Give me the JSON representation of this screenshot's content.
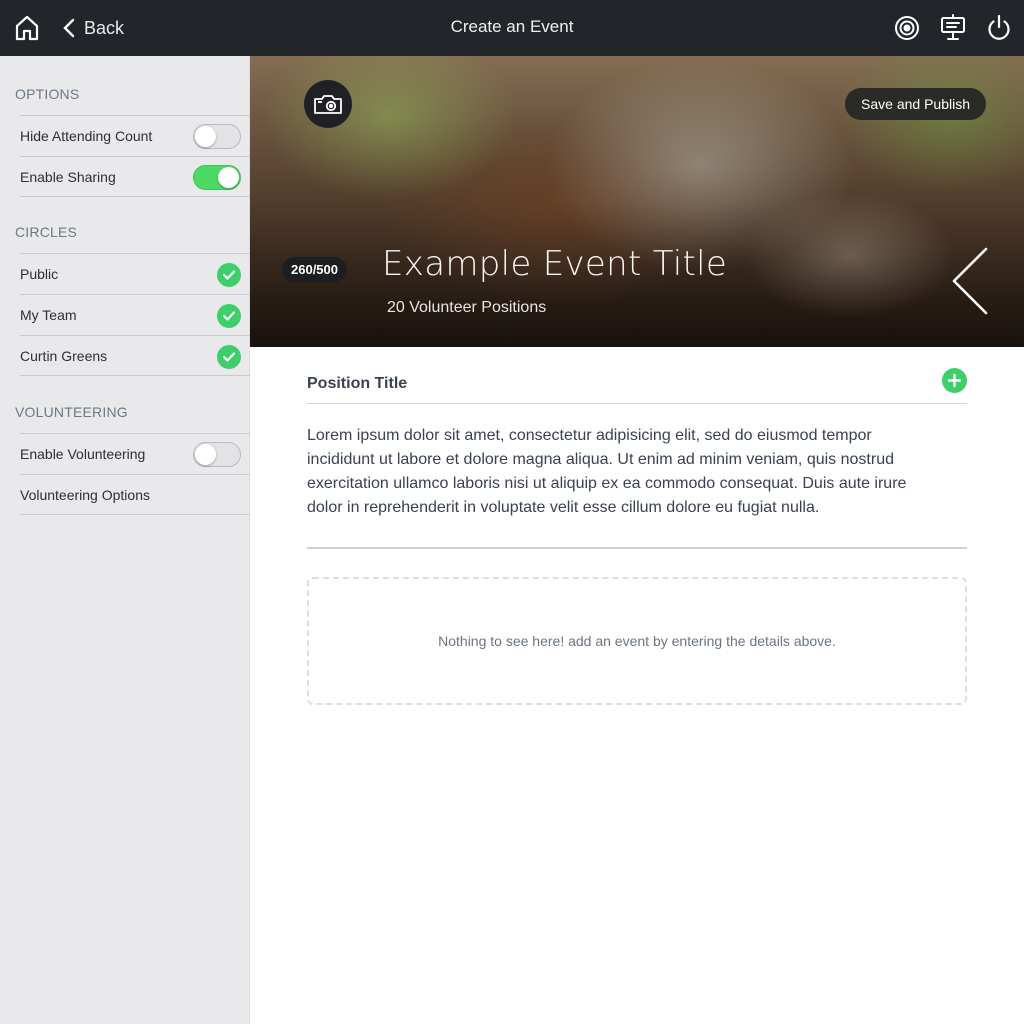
{
  "topbar": {
    "title": "Create an Event",
    "back_label": "Back",
    "icons": [
      "home-icon",
      "chevron-left-icon",
      "target-icon",
      "presentation-icon",
      "power-icon"
    ]
  },
  "sidebar": {
    "options": {
      "heading": "OPTIONS",
      "items": [
        {
          "label": "Hide Attending Count",
          "control": "toggle",
          "on": false
        },
        {
          "label": "Enable Sharing",
          "control": "toggle",
          "on": true
        }
      ]
    },
    "circles": {
      "heading": "CIRCLES",
      "items": [
        {
          "label": "Public",
          "checked": true
        },
        {
          "label": "My Team",
          "checked": true
        },
        {
          "label": "Curtin Greens",
          "checked": true
        }
      ]
    },
    "volunteering": {
      "heading": "VOLUNTEERING",
      "items": [
        {
          "label": "Enable Volunteering",
          "control": "toggle",
          "on": false
        },
        {
          "label": "Volunteering Options",
          "control": "link"
        }
      ]
    }
  },
  "hero": {
    "save_publish_label": "Save and Publish",
    "char_count": "260/500",
    "event_title": "Example Event Title",
    "subtitle": "20 Volunteer Positions"
  },
  "main": {
    "position_title": "Position Title",
    "description": "Lorem ipsum dolor sit amet, consectetur adipisicing elit, sed do eiusmod tempor incididunt ut labore et dolore magna aliqua. Ut enim ad minim veniam, quis nostrud exercitation ullamco laboris nisi ut aliquip ex ea commodo consequat. Duis aute irure dolor in reprehenderit in voluptate velit esse cillum dolore eu fugiat nulla.",
    "empty_state": "Nothing to see here! add an event by entering the details above."
  },
  "colors": {
    "topbar": "#22262b",
    "sidebar": "#e9e9eb",
    "accent_green": "#4cd964",
    "check_green": "#3fcf6a"
  }
}
